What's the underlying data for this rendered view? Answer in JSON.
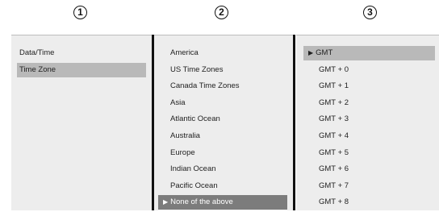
{
  "markers": [
    "1",
    "2",
    "3"
  ],
  "menu_level1": {
    "items": [
      {
        "label": "Data/Time"
      },
      {
        "label": "Time Zone",
        "selected": true
      }
    ]
  },
  "menu_level2": {
    "items": [
      {
        "label": "America"
      },
      {
        "label": "US Time Zones"
      },
      {
        "label": "Canada Time Zones"
      },
      {
        "label": "Asia"
      },
      {
        "label": "Atlantic Ocean"
      },
      {
        "label": "Australia"
      },
      {
        "label": "Europe"
      },
      {
        "label": "Indian Ocean"
      },
      {
        "label": "Pacific Ocean"
      },
      {
        "label": "None of the above",
        "selected": true
      }
    ]
  },
  "menu_level3": {
    "items": [
      {
        "label": "GMT",
        "selected": true
      },
      {
        "label": "GMT + 0"
      },
      {
        "label": "GMT + 1"
      },
      {
        "label": "GMT + 2"
      },
      {
        "label": "GMT + 3"
      },
      {
        "label": "GMT + 4"
      },
      {
        "label": "GMT + 5"
      },
      {
        "label": "GMT + 6"
      },
      {
        "label": "GMT + 7"
      },
      {
        "label": "GMT + 8"
      }
    ]
  },
  "arrow_glyph": "▶",
  "colors": {
    "panel_bg": "#ededed",
    "highlight_light": "#b9b9b9",
    "highlight_dark": "#7c7c7c",
    "separator": "#111111"
  }
}
